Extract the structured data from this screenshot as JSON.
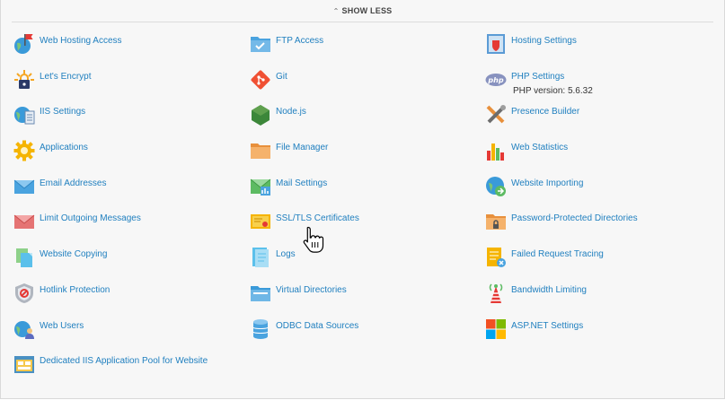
{
  "show_less": {
    "label": "SHOW LESS",
    "icon": "chevron-up-icon"
  },
  "columns": [
    [
      {
        "label": "Web Hosting Access",
        "icon": "globe-flag-icon"
      },
      {
        "label": "Let's Encrypt",
        "icon": "lock-icon"
      },
      {
        "label": "IIS Settings",
        "icon": "iis-globe-icon"
      },
      {
        "label": "Applications",
        "icon": "gear-icon"
      },
      {
        "label": "Email Addresses",
        "icon": "envelope-icon"
      },
      {
        "label": "Limit Outgoing Messages",
        "icon": "envelope-limit-icon"
      },
      {
        "label": "Website Copying",
        "icon": "copy-icon"
      },
      {
        "label": "Hotlink Protection",
        "icon": "shield-icon"
      },
      {
        "label": "Web Users",
        "icon": "users-globe-icon"
      },
      {
        "label": "Dedicated IIS Application Pool for Website",
        "icon": "app-pool-icon"
      }
    ],
    [
      {
        "label": "FTP Access",
        "icon": "ftp-folder-icon"
      },
      {
        "label": "Git",
        "icon": "git-icon"
      },
      {
        "label": "Node.js",
        "icon": "nodejs-icon"
      },
      {
        "label": "File Manager",
        "icon": "folder-icon"
      },
      {
        "label": "Mail Settings",
        "icon": "mail-settings-icon"
      },
      {
        "label": "SSL/TLS Certificates",
        "icon": "certificate-icon"
      },
      {
        "label": "Logs",
        "icon": "logs-icon"
      },
      {
        "label": "Virtual Directories",
        "icon": "virtual-directory-icon"
      },
      {
        "label": "ODBC Data Sources",
        "icon": "database-icon"
      }
    ],
    [
      {
        "label": "Hosting Settings",
        "icon": "hosting-settings-icon"
      },
      {
        "label": "PHP Settings",
        "sub": "PHP version: 5.6.32",
        "icon": "php-icon"
      },
      {
        "label": "Presence Builder",
        "icon": "tools-icon"
      },
      {
        "label": "Web Statistics",
        "icon": "bar-chart-icon"
      },
      {
        "label": "Website Importing",
        "icon": "import-globe-icon"
      },
      {
        "label": "Password-Protected Directories",
        "icon": "locked-folder-icon"
      },
      {
        "label": "Failed Request Tracing",
        "icon": "trace-icon"
      },
      {
        "label": "Bandwidth Limiting",
        "icon": "antenna-icon"
      },
      {
        "label": "ASP.NET Settings",
        "icon": "aspnet-icon"
      }
    ]
  ]
}
